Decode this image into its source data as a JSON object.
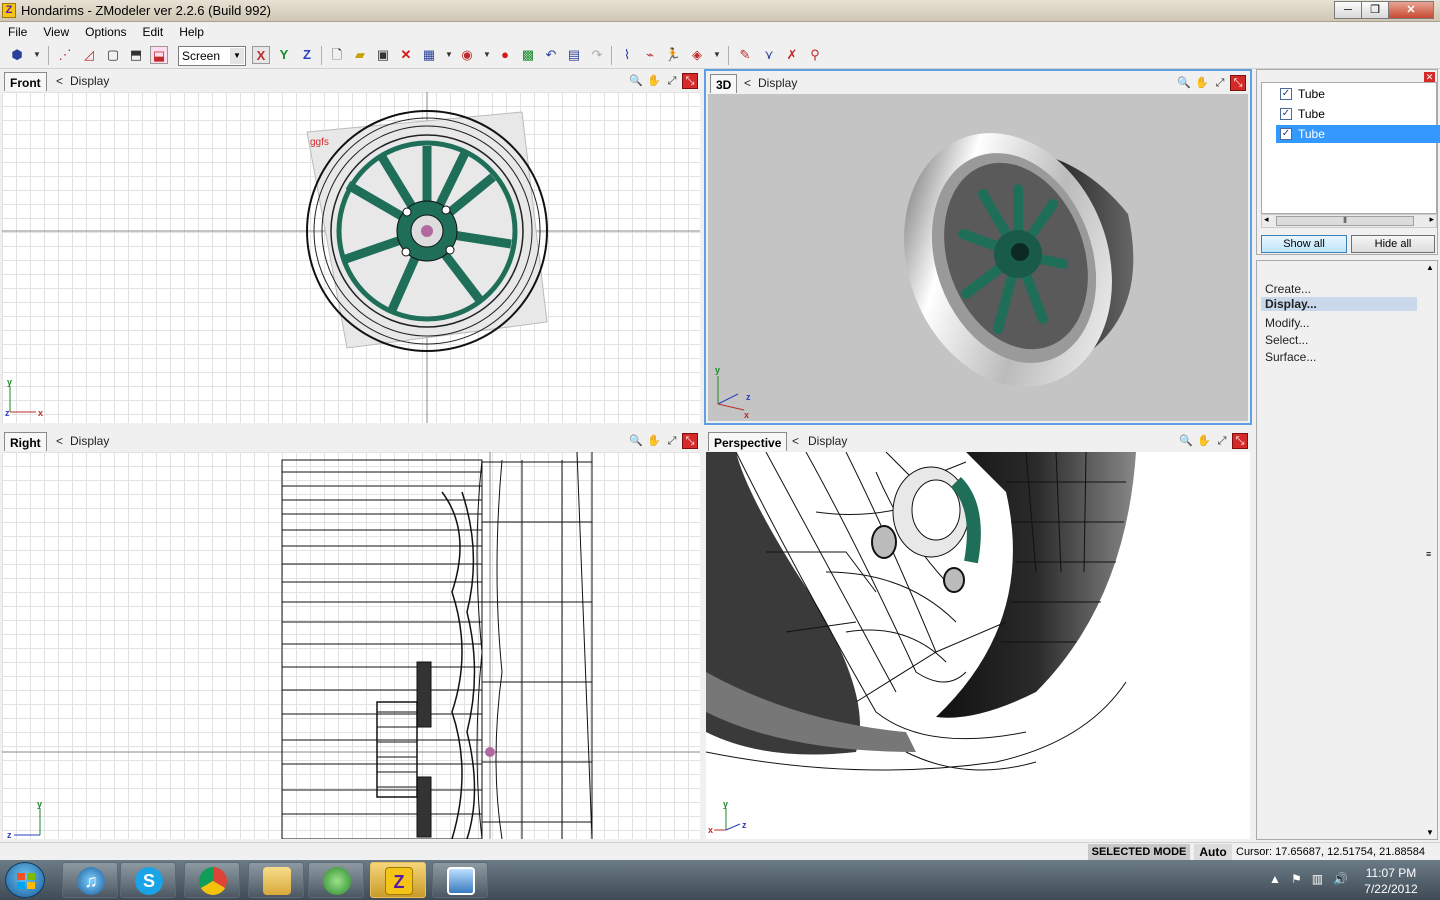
{
  "window": {
    "title": "Hondarims - ZModeler ver 2.2.6 (Build 992)",
    "logo": "Z",
    "minimize": "─",
    "maximize": "❐",
    "close": "✕"
  },
  "menu": [
    "File",
    "View",
    "Options",
    "Edit",
    "Help"
  ],
  "toolbar": {
    "axis_x": "X",
    "axis_y": "Y",
    "axis_z": "Z",
    "screen_select": "Screen"
  },
  "viewports": {
    "front": {
      "name": "Front",
      "arrow": "<",
      "display": "Display",
      "label_text": "ggfs"
    },
    "three_d": {
      "name": "3D",
      "arrow": "<",
      "display": "Display"
    },
    "right": {
      "name": "Right",
      "arrow": "<",
      "display": "Display"
    },
    "perspective": {
      "name": "Perspective",
      "arrow": "<",
      "display": "Display"
    }
  },
  "axes": {
    "x": "x",
    "y": "y",
    "z": "z"
  },
  "objects": {
    "items": [
      {
        "label": "Tube",
        "checked": true
      },
      {
        "label": "Tube",
        "checked": true
      },
      {
        "label": "Tube",
        "checked": true,
        "selected": true
      }
    ],
    "show_all": "Show all",
    "hide_all": "Hide all"
  },
  "commands": [
    "Create...",
    "Display...",
    "Modify...",
    "Select...",
    "Surface..."
  ],
  "status": {
    "mode": "SELECTED MODE",
    "auto": "Auto",
    "cursor": "Cursor: 17.65687, 12.51754, 21.88584"
  },
  "taskbar": {
    "time": "11:07 PM",
    "date": "7/22/2012"
  },
  "colors": {
    "rim_green": "#1f6e58",
    "select_blue": "#3399ff",
    "viewport_gray": "#c4c4c4"
  }
}
